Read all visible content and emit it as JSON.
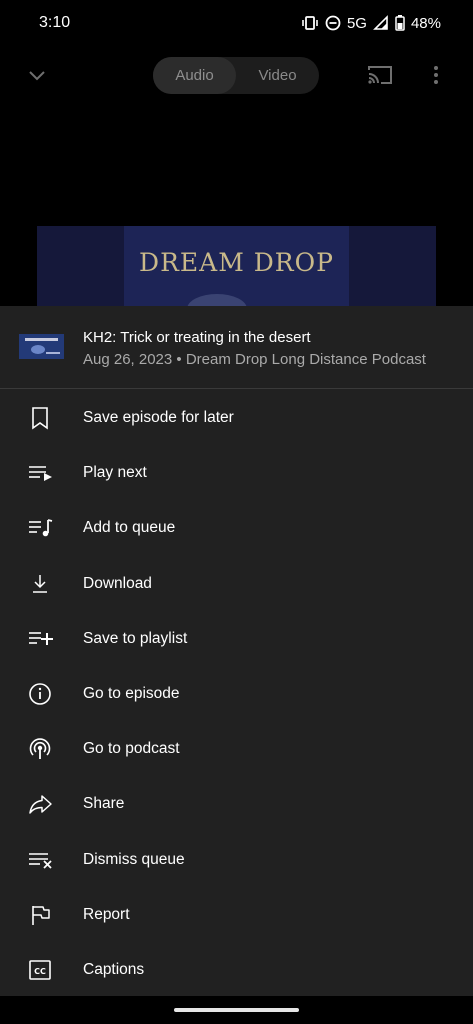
{
  "status_bar": {
    "time": "3:10",
    "network": "5G",
    "battery": "48%"
  },
  "player": {
    "toggle": {
      "audio_label": "Audio",
      "video_label": "Video",
      "selected": "Audio"
    },
    "artwork_title": "DREAM DROP"
  },
  "sheet": {
    "episode_title": "KH2: Trick or treating in the desert",
    "episode_subtitle": "Aug 26, 2023 • Dream Drop Long Distance Podcast",
    "items": [
      {
        "label": "Save episode for later",
        "icon": "bookmark-icon"
      },
      {
        "label": "Play next",
        "icon": "play-next-icon"
      },
      {
        "label": "Add to queue",
        "icon": "queue-music-icon"
      },
      {
        "label": "Download",
        "icon": "download-icon"
      },
      {
        "label": "Save to playlist",
        "icon": "playlist-add-icon"
      },
      {
        "label": "Go to episode",
        "icon": "info-icon"
      },
      {
        "label": "Go to podcast",
        "icon": "podcast-icon"
      },
      {
        "label": "Share",
        "icon": "share-icon"
      },
      {
        "label": "Dismiss queue",
        "icon": "dismiss-queue-icon"
      },
      {
        "label": "Report",
        "icon": "flag-icon"
      },
      {
        "label": "Captions",
        "icon": "captions-icon"
      }
    ]
  },
  "colors": {
    "sheet_background": "#212121",
    "background": "#000000",
    "secondary_text": "#aaaaaa"
  }
}
